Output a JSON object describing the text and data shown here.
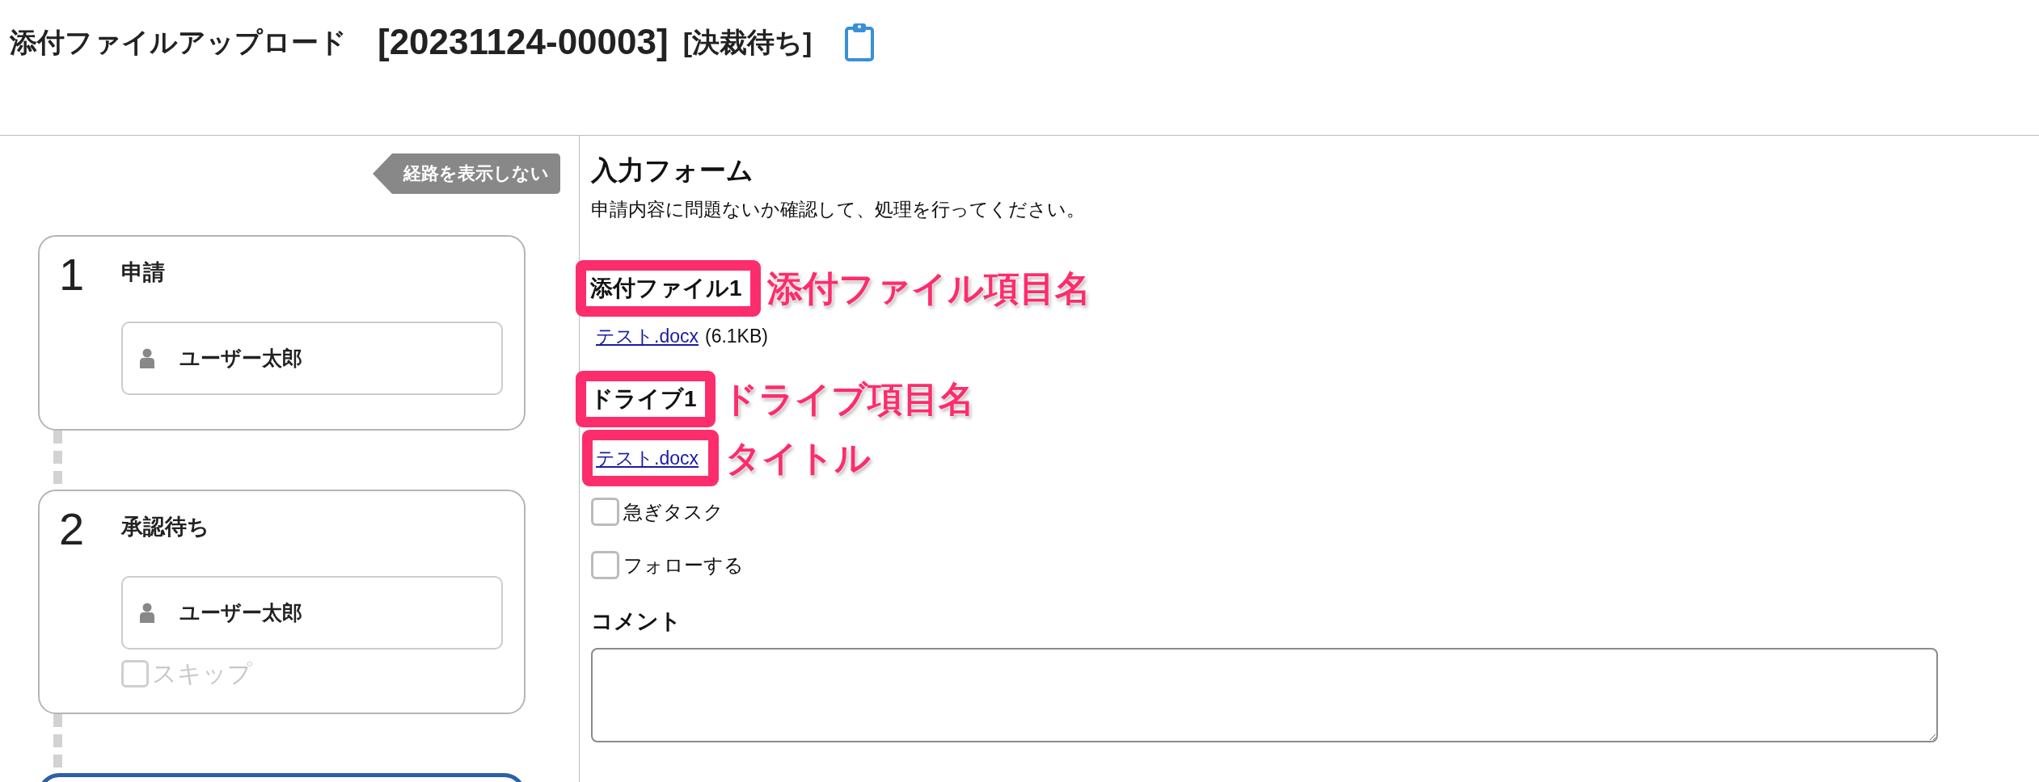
{
  "header": {
    "title": "添付ファイルアップロード",
    "request_id": "[20231124-00003]",
    "status": "[決裁待ち]"
  },
  "route": {
    "toggle_button": "経路を表示しない",
    "steps": [
      {
        "number": "1",
        "title": "申請",
        "assignee": "ユーザー太郎",
        "current": false
      },
      {
        "number": "2",
        "title": "承認待ち",
        "assignee": "ユーザー太郎",
        "skip": {
          "label": "スキップ",
          "checked": false,
          "disabled": true
        },
        "current": false
      },
      {
        "current": true
      }
    ]
  },
  "form": {
    "title": "入力フォーム",
    "description": "申請内容に問題ないか確認して、処理を行ってください。",
    "fields": [
      {
        "kind": "attachment",
        "label": "添付ファイル1",
        "highlighted": true,
        "annotation": "添付ファイル項目名",
        "file": {
          "name": "テスト.docx",
          "size": "(6.1KB)"
        }
      },
      {
        "kind": "drive",
        "label": "ドライブ1",
        "highlighted": true,
        "annotation": "ドライブ項目名",
        "link": {
          "text": "テスト.docx",
          "highlighted": true,
          "annotation": "タイトル"
        }
      }
    ],
    "options": [
      {
        "label": "急ぎタスク",
        "checked": false
      },
      {
        "label": "フォローする",
        "checked": false
      }
    ],
    "comment": {
      "label": "コメント"
    }
  }
}
